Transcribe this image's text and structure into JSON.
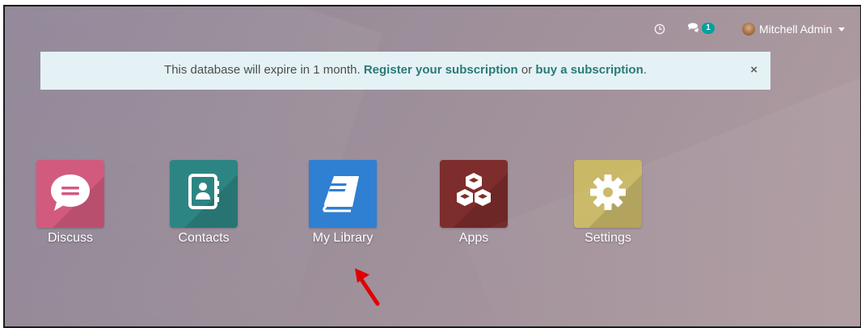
{
  "topbar": {
    "chat_badge": "1",
    "user_name": "Mitchell Admin"
  },
  "banner": {
    "text_before": "This database will expire in 1 month. ",
    "link_register": "Register your subscription",
    "text_middle": " or ",
    "link_buy": "buy a subscription",
    "text_after": ".",
    "close": "×"
  },
  "apps": [
    {
      "label": "Discuss",
      "color": "#d35a7f"
    },
    {
      "label": "Contacts",
      "color": "#2d8583"
    },
    {
      "label": "My Library",
      "color": "#2f7fd2"
    },
    {
      "label": "Apps",
      "color": "#7e2d2d"
    },
    {
      "label": "Settings",
      "color": "#c9b865"
    }
  ]
}
